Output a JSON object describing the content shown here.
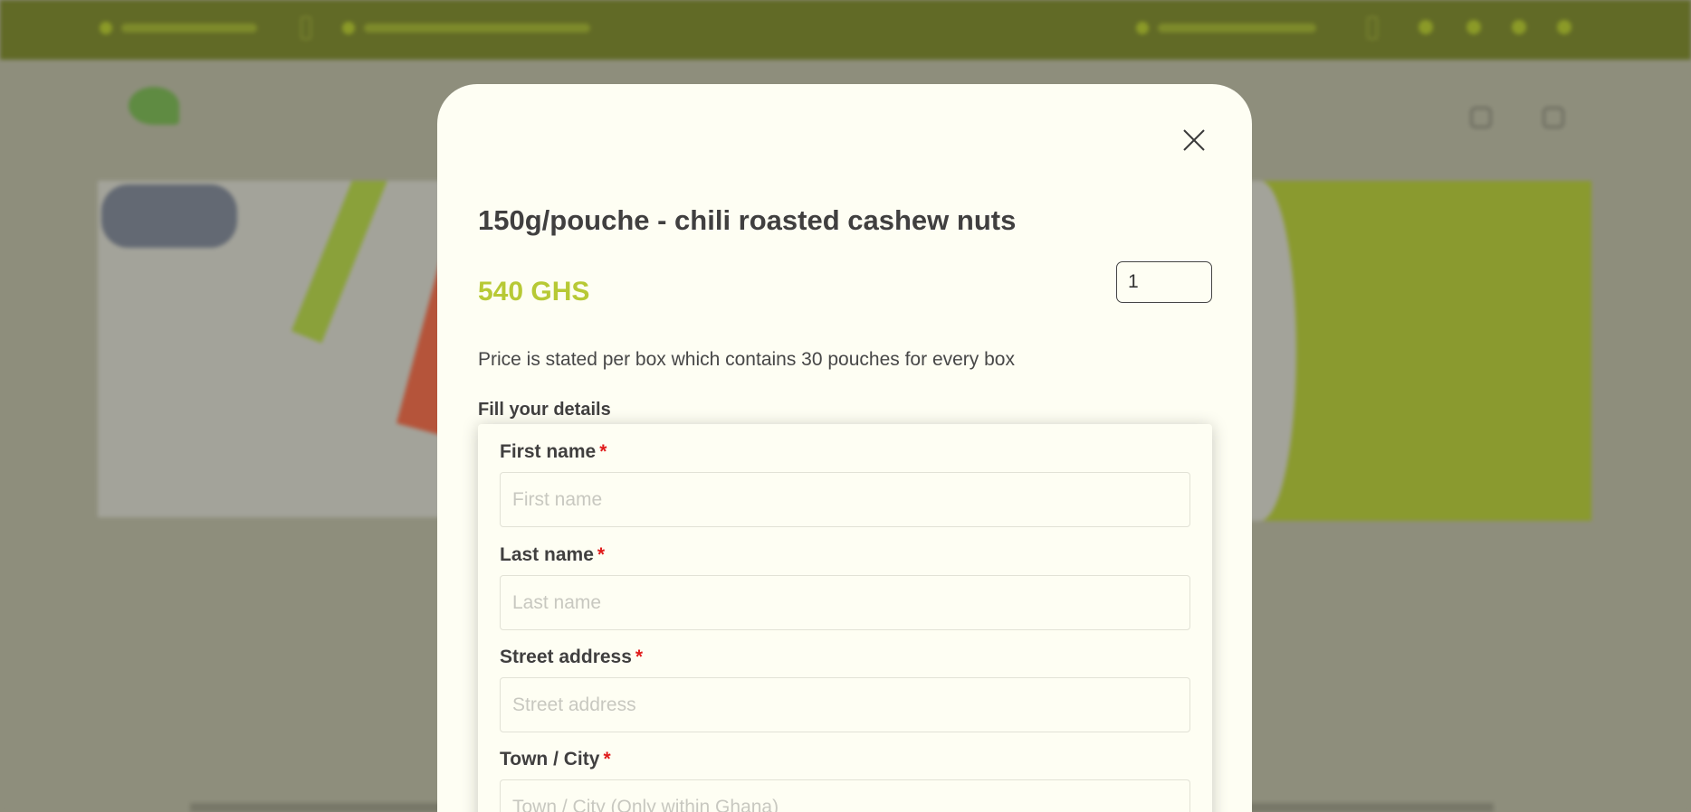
{
  "background": {
    "icon_names": [
      "phone-icon",
      "email-icon",
      "clock-icon",
      "cart-icon",
      "user-icon",
      "facebook-icon",
      "twitter-icon",
      "instagram-icon",
      "linkedin-icon"
    ],
    "colors": {
      "topbar": "#616a26",
      "overlay": "#8e8e7c",
      "banner_green": "#8a9a2f"
    }
  },
  "modal": {
    "close_icon": "close-icon",
    "product_title": "150g/pouche - chili roasted cashew nuts",
    "price": "540 GHS",
    "quantity_value": "1",
    "price_note": "Price is stated per box which contains 30 pouches for every box",
    "fill_details_label": "Fill your details",
    "required_marker": "*",
    "colors": {
      "modal_bg": "#fefef3",
      "price": "#b7c935",
      "required": "#e01b1b",
      "text": "#403f3f"
    },
    "fields": [
      {
        "label": "First name",
        "placeholder": "First name"
      },
      {
        "label": "Last name",
        "placeholder": "Last name"
      },
      {
        "label": "Street address",
        "placeholder": "Street address"
      },
      {
        "label": "Town / City",
        "placeholder": "Town / City (Only within Ghana)"
      }
    ]
  }
}
